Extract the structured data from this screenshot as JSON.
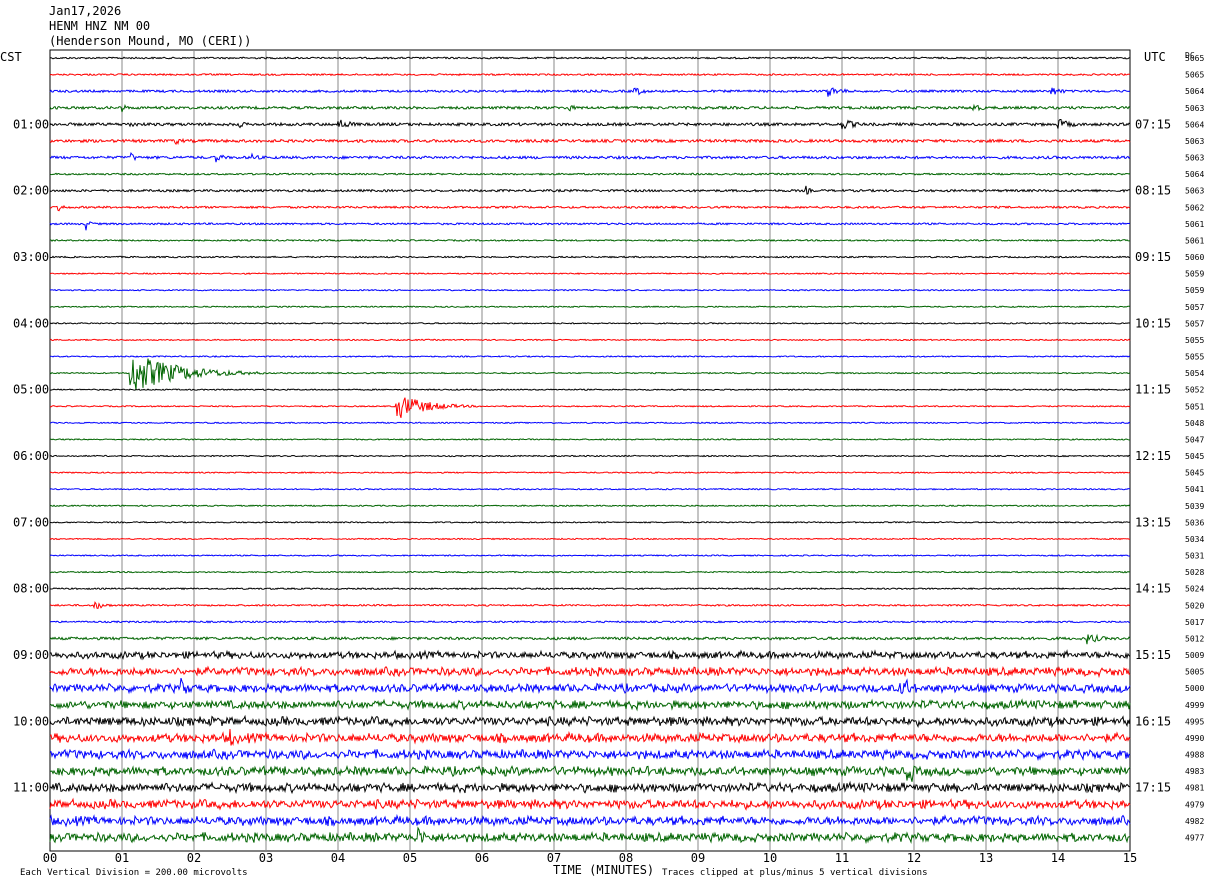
{
  "header": {
    "date": "Jan17,2026",
    "station": "HENM HNZ NM 00",
    "location": "(Henderson Mound, MO (CERI))"
  },
  "labels": {
    "left_zone": "CST",
    "right_zone": "UTC",
    "dc_label": "DC",
    "x_axis_title": "TIME (MINUTES)",
    "scale_note": "Each Vertical Division =  200.00 microvolts",
    "clip_note": "Traces clipped at plus/minus 5 vertical divisions"
  },
  "colors": {
    "trace_cycle": [
      "#000000",
      "#ff0000",
      "#0000ff",
      "#006400"
    ],
    "grid": "#888888"
  },
  "chart_data": {
    "type": "line",
    "description_units": "helicorder seismogram, 15-minute lines",
    "x": {
      "label": "TIME (MINUTES)",
      "range": [
        0,
        15
      ],
      "ticks": [
        "00",
        "01",
        "02",
        "03",
        "04",
        "05",
        "06",
        "07",
        "08",
        "09",
        "10",
        "11",
        "12",
        "13",
        "14",
        "15"
      ]
    },
    "cst_hour_labels": [
      "01:00",
      "02:00",
      "03:00",
      "04:00",
      "05:00",
      "06:00",
      "07:00",
      "08:00",
      "09:00",
      "10:00",
      "11:00"
    ],
    "utc_hour_labels": [
      "07:15",
      "08:15",
      "09:15",
      "10:15",
      "11:15",
      "12:15",
      "13:15",
      "14:15",
      "15:15",
      "16:15",
      "17:15"
    ],
    "dc_offsets": [
      5065,
      5065,
      5064,
      5063,
      5064,
      5063,
      5063,
      5064,
      5063,
      5062,
      5061,
      5061,
      5060,
      5059,
      5059,
      5057,
      5057,
      5055,
      5055,
      5054,
      5052,
      5051,
      5048,
      5047,
      5045,
      5045,
      5041,
      5039,
      5036,
      5034,
      5031,
      5028,
      5024,
      5020,
      5017,
      5012,
      5009,
      5005,
      5000,
      4999,
      4995,
      4990,
      4988,
      4983,
      4981,
      4979,
      4982,
      4977
    ],
    "trace_amplitude": [
      0.8,
      0.8,
      1.1,
      1.3,
      1.4,
      1.4,
      1.3,
      0.8,
      1.1,
      1.0,
      0.9,
      0.7,
      0.7,
      0.6,
      0.6,
      0.6,
      0.6,
      0.6,
      0.6,
      0.6,
      0.6,
      0.6,
      0.6,
      0.6,
      0.6,
      0.6,
      0.6,
      0.6,
      0.6,
      0.6,
      0.6,
      0.6,
      0.7,
      0.8,
      0.8,
      1.3,
      3.0,
      3.5,
      3.5,
      3.5,
      3.8,
      3.8,
      3.8,
      3.8,
      3.8,
      3.8,
      3.8,
      3.8
    ],
    "events": [
      {
        "line": 2,
        "minute": 8.1,
        "amp": 6,
        "dur": 0.4
      },
      {
        "line": 2,
        "minute": 10.8,
        "amp": 6,
        "dur": 0.6
      },
      {
        "line": 2,
        "minute": 13.9,
        "amp": 5,
        "dur": 0.5
      },
      {
        "line": 3,
        "minute": 1.0,
        "amp": 5,
        "dur": 0.2
      },
      {
        "line": 3,
        "minute": 7.2,
        "amp": 6,
        "dur": 0.2
      },
      {
        "line": 3,
        "minute": 12.8,
        "amp": 6,
        "dur": 0.4
      },
      {
        "line": 4,
        "minute": 1.1,
        "amp": 5,
        "dur": 0.3
      },
      {
        "line": 4,
        "minute": 2.6,
        "amp": 5,
        "dur": 0.3
      },
      {
        "line": 4,
        "minute": 4.0,
        "amp": 6,
        "dur": 0.6
      },
      {
        "line": 4,
        "minute": 11.0,
        "amp": 6,
        "dur": 0.6
      },
      {
        "line": 4,
        "minute": 14.0,
        "amp": 6,
        "dur": 0.6
      },
      {
        "line": 5,
        "minute": 1.7,
        "amp": 5,
        "dur": 0.4
      },
      {
        "line": 6,
        "minute": 1.1,
        "amp": 6,
        "dur": 0.3
      },
      {
        "line": 6,
        "minute": 2.3,
        "amp": 6,
        "dur": 0.3
      },
      {
        "line": 6,
        "minute": 2.8,
        "amp": 5,
        "dur": 0.3
      },
      {
        "line": 8,
        "minute": 10.5,
        "amp": 5,
        "dur": 0.2
      },
      {
        "line": 9,
        "minute": 0.1,
        "amp": 5,
        "dur": 0.3
      },
      {
        "line": 10,
        "minute": 0.5,
        "amp": 7,
        "dur": 0.2
      },
      {
        "line": 19,
        "minute": 1.1,
        "amp": 22,
        "dur": 1.9
      },
      {
        "line": 21,
        "minute": 4.8,
        "amp": 14,
        "dur": 1.2
      },
      {
        "line": 33,
        "minute": 0.6,
        "amp": 5,
        "dur": 0.5
      },
      {
        "line": 35,
        "minute": 14.4,
        "amp": 6,
        "dur": 0.6
      },
      {
        "line": 38,
        "minute": 1.8,
        "amp": 10,
        "dur": 0.5
      },
      {
        "line": 38,
        "minute": 11.8,
        "amp": 12,
        "dur": 0.6
      },
      {
        "line": 41,
        "minute": 2.5,
        "amp": 12,
        "dur": 0.3
      },
      {
        "line": 43,
        "minute": 11.9,
        "amp": 14,
        "dur": 0.4
      },
      {
        "line": 47,
        "minute": 5.1,
        "amp": 12,
        "dur": 0.5
      }
    ]
  }
}
